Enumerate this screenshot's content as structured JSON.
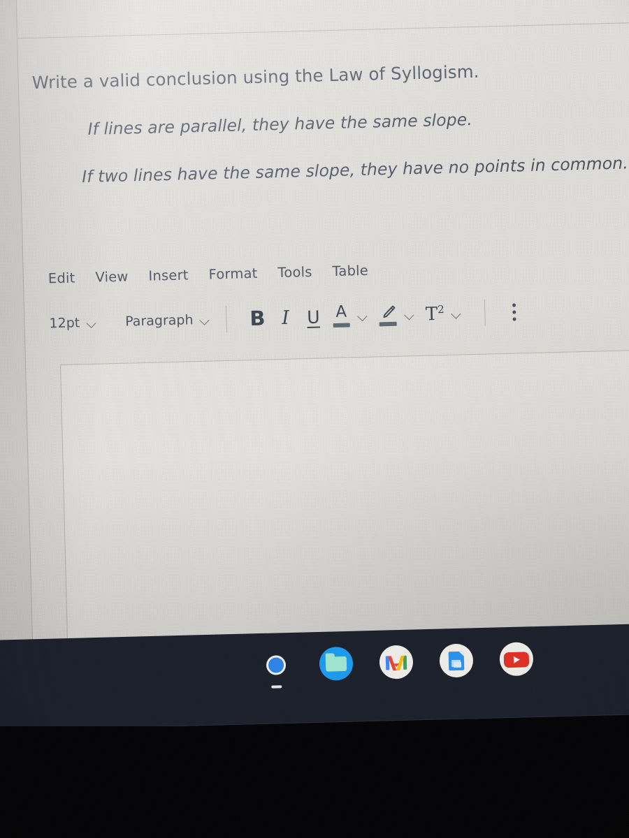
{
  "question": {
    "stem": "Write a valid conclusion using the Law of Syllogism.",
    "premise_1": "If lines are parallel, they have the same slope.",
    "premise_2": "If two lines have the same slope, they have no points in common."
  },
  "editor": {
    "menubar": [
      {
        "label": "Edit"
      },
      {
        "label": "View"
      },
      {
        "label": "Insert"
      },
      {
        "label": "Format"
      },
      {
        "label": "Tools"
      },
      {
        "label": "Table"
      }
    ],
    "toolbar": {
      "font_size": "12pt",
      "block_format": "Paragraph",
      "bold": "B",
      "italic": "I",
      "underline": "U",
      "text_color": "A",
      "highlight_color": "highlighter-icon",
      "superscript": "T",
      "superscript_exponent": "2",
      "more_options": "more-options-icon"
    },
    "content": ""
  },
  "shelf": {
    "apps": [
      {
        "name": "Google Chrome",
        "running": true
      },
      {
        "name": "Files",
        "running": false
      },
      {
        "name": "Gmail",
        "running": false
      },
      {
        "name": "Google Docs",
        "running": false
      },
      {
        "name": "YouTube",
        "running": false
      }
    ]
  },
  "colors": {
    "screen_background": "#e9e7e3",
    "text": "#4a5361",
    "toolbar_icon": "#3f4754",
    "border": "#b7b5af",
    "shelf": "#1b1f2b",
    "bezel": "#030305",
    "chrome_red": "#e03b2e",
    "chrome_yellow": "#f6c028",
    "chrome_green": "#3a9c4a",
    "chrome_blue": "#2e84e8",
    "files_blue": "#1a9bf0",
    "gmail_red": "#ea4335",
    "docs_blue": "#2a92ee",
    "youtube_red": "#e02f25"
  }
}
